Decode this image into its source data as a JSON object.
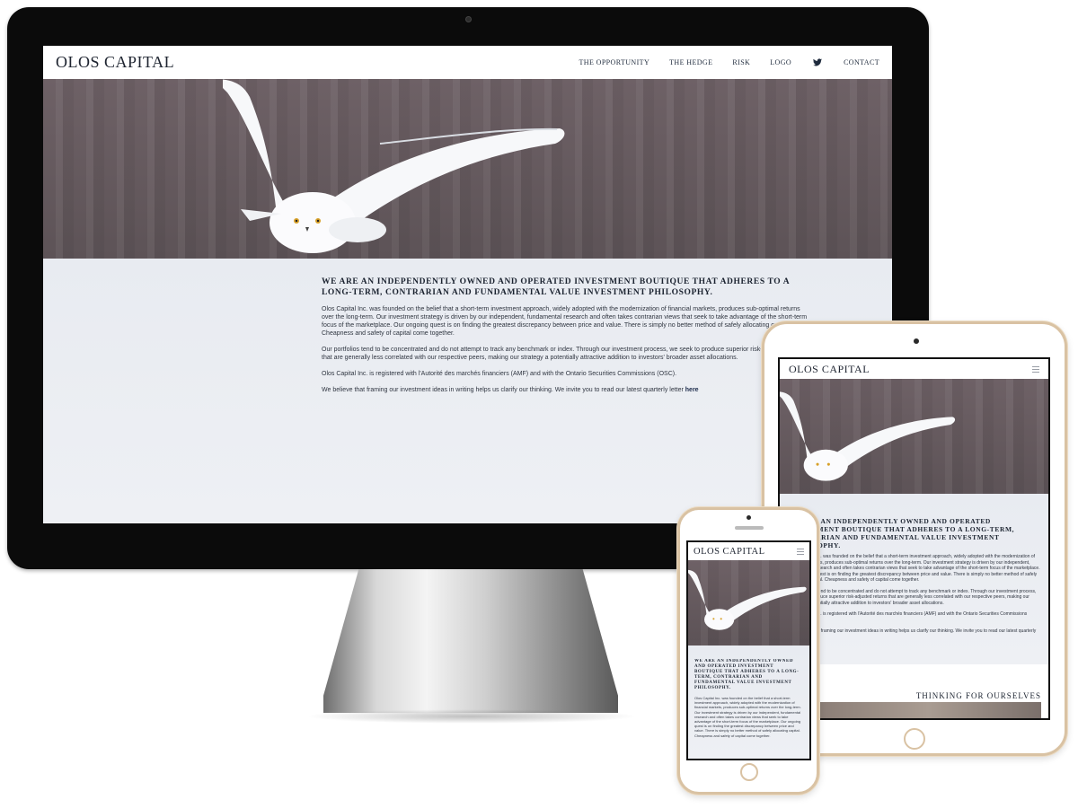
{
  "site": {
    "brand": "OLOS CAPITAL",
    "nav": [
      "THE OPPORTUNITY",
      "THE HEDGE",
      "RISK",
      "LOGO",
      "CONTACT"
    ],
    "twitter_icon": "twitter-icon",
    "menu_icon": "hamburger-menu-icon",
    "headline": "WE ARE AN INDEPENDENTLY OWNED AND OPERATED INVESTMENT BOUTIQUE THAT ADHERES TO A LONG-TERM, CONTRARIAN AND FUNDAMENTAL VALUE INVESTMENT PHILOSOPHY.",
    "paragraphs": [
      "Olos Capital Inc. was founded on the belief that a short-term investment approach, widely adopted with the modernization of financial markets, produces sub-optimal returns over the long-term. Our investment strategy is driven by our independent, fundamental research and often takes contrarian views that seek to take advantage of the short-term focus of the marketplace. Our ongoing quest is on finding the greatest discrepancy between price and value. There is simply no better method of safely allocating capital. Cheapness and safety of capital come together.",
      "Our portfolios tend to be concentrated and do not attempt to track any benchmark or index. Through our investment process, we seek to produce superior risk-adjusted returns that are generally less correlated with our respective peers, making our strategy a potentially attractive addition to investors' broader asset allocations.",
      "Olos Capital Inc. is registered with l'Autorité des marchés financiers (AMF) and with the Ontario Securities Commissions (OSC)."
    ],
    "letter_text": "We believe that framing our investment ideas in writing helps us clarify our thinking. We invite you to read our latest quarterly letter",
    "letter_link": "here",
    "section_title": "THINKING FOR OURSELVES"
  },
  "colors": {
    "accent": "#1b2a4a",
    "device_gold": "#d9c2a3",
    "imac_bezel": "#0b0b0b"
  }
}
